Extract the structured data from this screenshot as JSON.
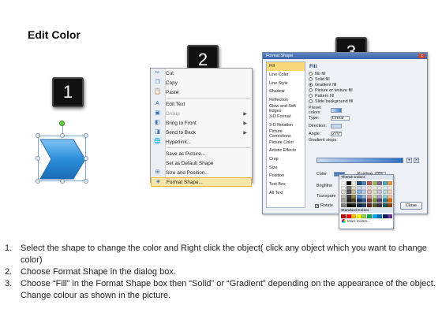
{
  "page_title": "Edit Color",
  "steps": [
    "1",
    "2",
    "3"
  ],
  "context_menu": {
    "items": [
      {
        "label": "Cut",
        "icon": "scissors-icon",
        "glyph": "✂",
        "disabled": false
      },
      {
        "label": "Copy",
        "icon": "copy-icon",
        "glyph": "❐",
        "disabled": false
      },
      {
        "label": "Paste",
        "icon": "paste-icon",
        "glyph": "📋",
        "disabled": false
      },
      {
        "sep": true
      },
      {
        "label": "Edit Text",
        "icon": "edit-text-icon",
        "glyph": "A",
        "disabled": false
      },
      {
        "label": "Group",
        "icon": "group-icon",
        "glyph": "▣",
        "disabled": true,
        "submenu": true
      },
      {
        "label": "Bring to Front",
        "icon": "bring-to-front-icon",
        "glyph": "◧",
        "disabled": false,
        "submenu": true
      },
      {
        "label": "Send to Back",
        "icon": "send-to-back-icon",
        "glyph": "◨",
        "disabled": false,
        "submenu": true
      },
      {
        "label": "Hyperlink...",
        "icon": "hyperlink-icon",
        "glyph": "🌐",
        "disabled": false
      },
      {
        "sep": true
      },
      {
        "label": "Save as Picture...",
        "icon": "",
        "glyph": "",
        "disabled": false
      },
      {
        "label": "Set as Default Shape",
        "icon": "",
        "glyph": "",
        "disabled": false
      },
      {
        "label": "Size and Position...",
        "icon": "size-position-icon",
        "glyph": "⊞",
        "disabled": false
      },
      {
        "label": "Format Shape...",
        "icon": "format-shape-icon",
        "glyph": "◈",
        "disabled": false,
        "highlighted": true
      }
    ]
  },
  "dialog": {
    "title": "Format Shape",
    "close_x": "x",
    "nav_items": [
      "Fill",
      "Line Color",
      "Line Style",
      "Shadow",
      "Reflection",
      "Glow and Soft Edges",
      "3-D Format",
      "3-D Rotation",
      "Picture Corrections",
      "Picture Color",
      "Artistic Effects",
      "Crop",
      "Size",
      "Position",
      "Text Box",
      "Alt Text"
    ],
    "selected_nav": "Fill",
    "fill_heading": "Fill",
    "fill_options": [
      {
        "label": "No fill",
        "on": false
      },
      {
        "label": "Solid fill",
        "on": false
      },
      {
        "label": "Gradient fill",
        "on": true
      },
      {
        "label": "Picture or texture fill",
        "on": false
      },
      {
        "label": "Pattern fill",
        "on": false
      },
      {
        "label": "Slide background fill",
        "on": false
      }
    ],
    "preset_colors_label": "Preset colors:",
    "type_label": "Type:",
    "type_value": "Linear",
    "direction_label": "Direction:",
    "angle_label": "Angle:",
    "angle_value": "270°",
    "gradient_stops_label": "Gradient stops",
    "color_label": "Color",
    "position_label": "Position:",
    "position_value": "0%",
    "brightness_label": "Brightne",
    "transparency_label": "Transpare",
    "rotate_label": "Rotate",
    "theme_colors_heading": "Theme Colors",
    "standard_colors_heading": "Standard Colors",
    "more_colors_label": "More Colors...",
    "close_button": "Close",
    "theme_colors": [
      "#ffffff",
      "#000000",
      "#eeece1",
      "#1f497d",
      "#4f81bd",
      "#c0504d",
      "#9bbb59",
      "#8064a2",
      "#4bacc6",
      "#f79646",
      "#f2f2f2",
      "#7f7f7f",
      "#ddd9c3",
      "#c6d9f0",
      "#dbe5f1",
      "#f2dcdb",
      "#ebf1dd",
      "#e5e0ec",
      "#dbeef3",
      "#fdeada",
      "#d8d8d8",
      "#595959",
      "#c4bd97",
      "#8db3e2",
      "#b8cce4",
      "#e5b9b7",
      "#d7e3bc",
      "#ccc1d9",
      "#b7dde8",
      "#fbd5b5",
      "#bfbfbf",
      "#3f3f3f",
      "#938953",
      "#548dd4",
      "#95b3d7",
      "#d99694",
      "#c3d69b",
      "#b2a2c7",
      "#92cddc",
      "#fac08f",
      "#a5a5a5",
      "#262626",
      "#494429",
      "#17365d",
      "#366092",
      "#953734",
      "#76923c",
      "#5f497a",
      "#31859b",
      "#e36c09",
      "#7f7f7f",
      "#0c0c0c",
      "#1d1b10",
      "#0f243e",
      "#244061",
      "#632423",
      "#4f6128",
      "#3f3151",
      "#205867",
      "#974806"
    ],
    "standard_colors": [
      "#c00000",
      "#ff0000",
      "#ffc000",
      "#ffff00",
      "#92d050",
      "#00b050",
      "#00b0f0",
      "#0070c0",
      "#002060",
      "#7030a0"
    ]
  },
  "instructions": [
    {
      "num": "1.",
      "text": "Select the shape to change the color and Right click the object( click any object which you want to change color)"
    },
    {
      "num": "2.",
      "text": "Choose Format Shape in the dialog box."
    },
    {
      "num": "3.",
      "text": "Choose “Fill” in the Format Shape box then “Solid” or “Gradient” depending on the appearance of the object. Change colour as shown in the picture."
    }
  ]
}
